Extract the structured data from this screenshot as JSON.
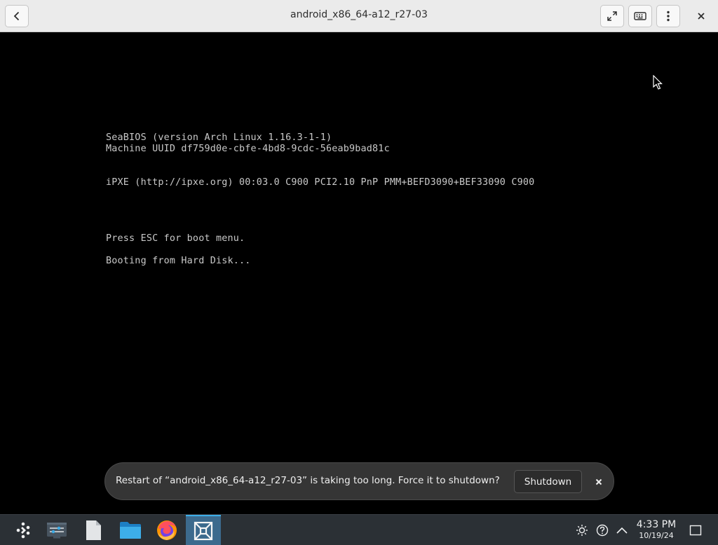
{
  "window": {
    "title": "android_x86_64-a12_r27-03",
    "buttons": {
      "back": "back-icon",
      "fullscreen": "fullscreen-icon",
      "keyboard": "keyboard-icon",
      "menu": "kebab-menu-icon",
      "close": "close-icon"
    }
  },
  "console": {
    "lines": [
      "SeaBIOS (version Arch Linux 1.16.3-1-1)",
      "Machine UUID df759d0e-cbfe-4bd8-9cdc-56eab9bad81c",
      "iPXE (http://ipxe.org) 00:03.0 C900 PCI2.10 PnP PMM+BEFD3090+BEF33090 C900",
      "Press ESC for boot menu.",
      "Booting from Hard Disk..."
    ],
    "text_color": "#c9c9c9"
  },
  "toast": {
    "message": "Restart of “android_x86_64-a12_r27-03” is taking too long. Force it to shutdown?",
    "action_label": "Shutdown"
  },
  "taskbar": {
    "apps": [
      "app-launcher-icon",
      "system-settings-icon",
      "text-file-icon",
      "file-manager-icon",
      "firefox-icon",
      "virtual-machine-icon"
    ],
    "tray": [
      "brightness-icon",
      "help-icon",
      "expand-tray-icon",
      "show-desktop-icon"
    ],
    "clock": {
      "time": "4:33 PM",
      "date": "10/19/24"
    },
    "accent": "#3daee9"
  }
}
